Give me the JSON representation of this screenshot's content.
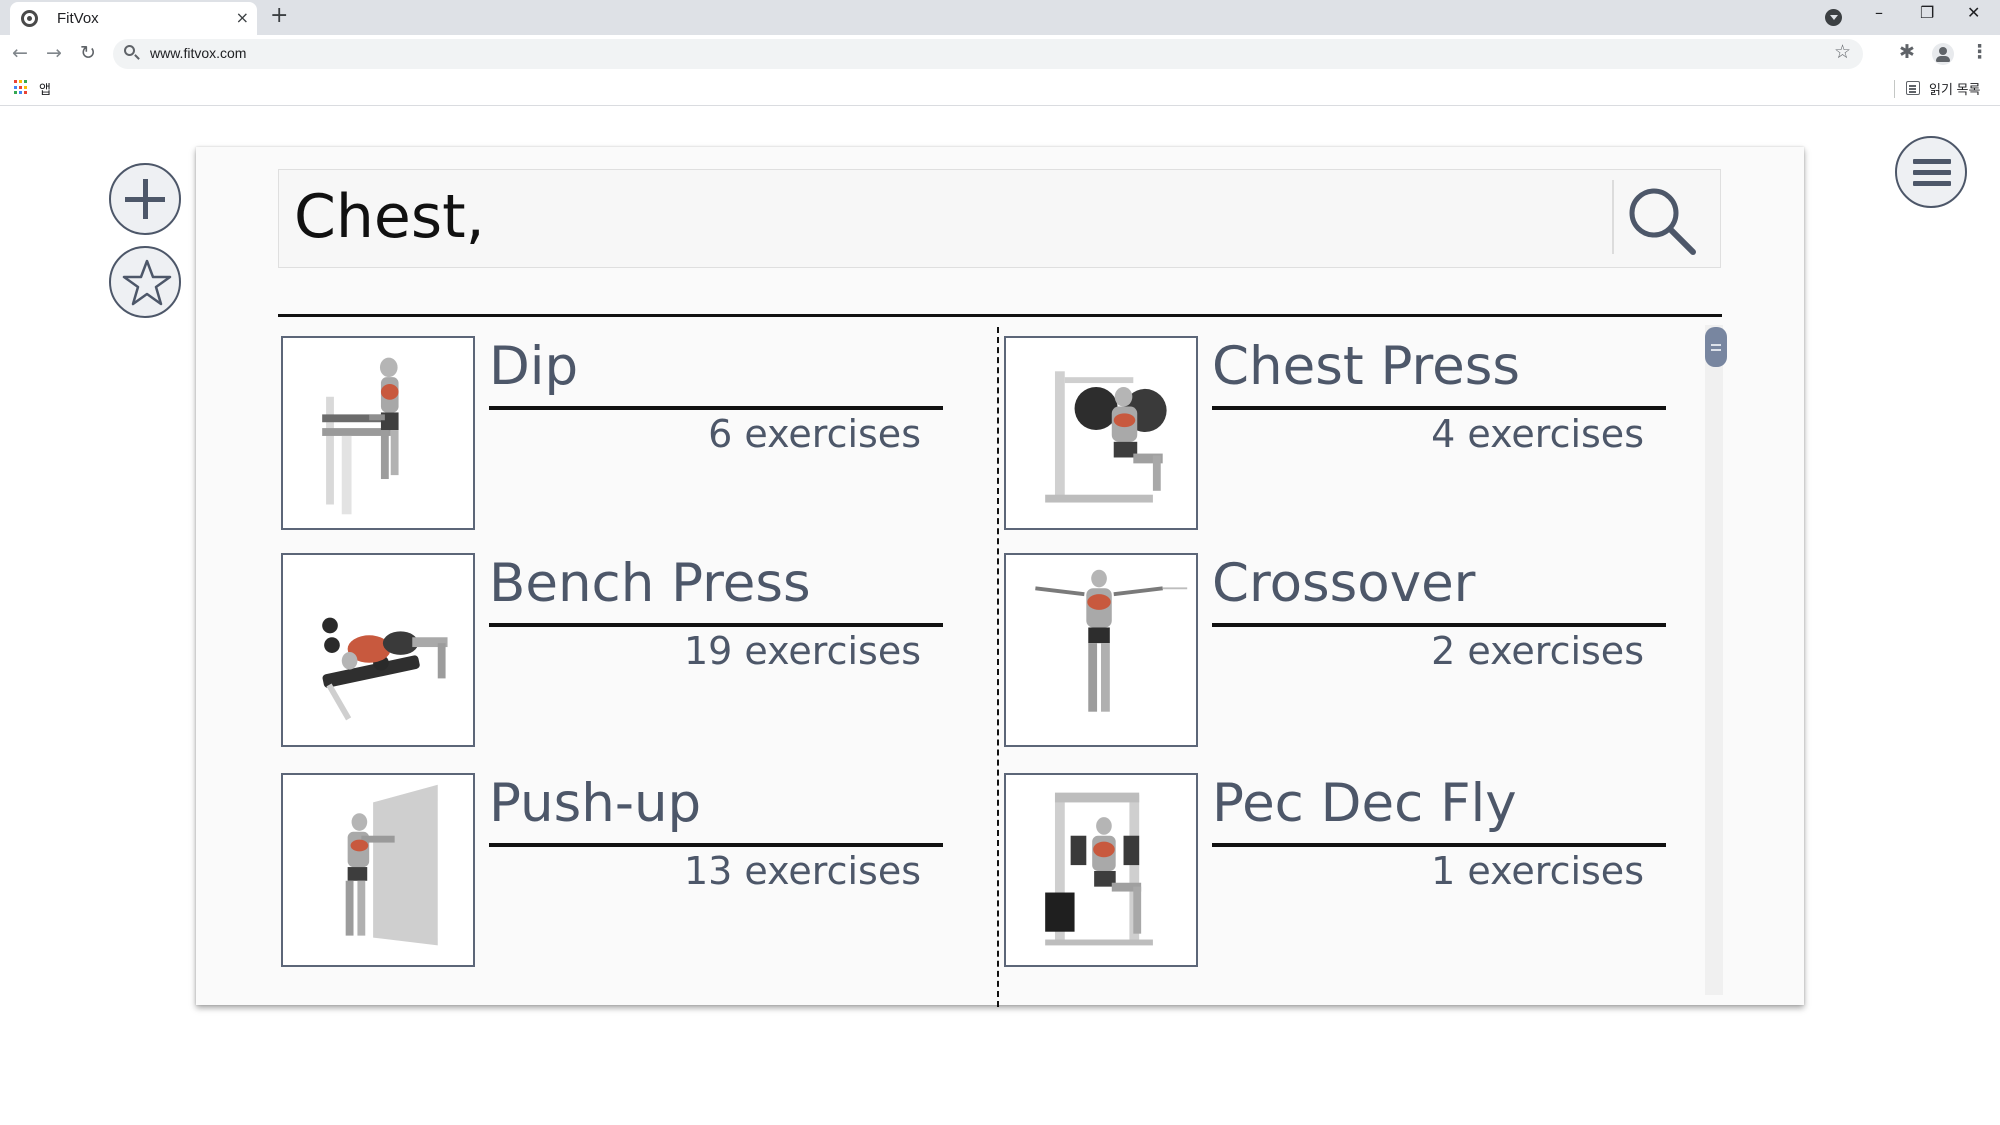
{
  "browser": {
    "tab_title": "FitVox",
    "tab_close": "×",
    "new_tab": "+",
    "url": "www.fitvox.com",
    "apps_label": "앱",
    "reading_list_label": "읽기 목록",
    "window_controls": [
      "–",
      "❐",
      "✕"
    ]
  },
  "app": {
    "search_query": "Chest,",
    "categories": [
      {
        "name": "Dip",
        "count": "6 exercises",
        "icon": "dip-exercise-illustration"
      },
      {
        "name": "Chest Press",
        "count": "4 exercises",
        "icon": "chest-press-machine-illustration"
      },
      {
        "name": "Bench Press",
        "count": "19 exercises",
        "icon": "bench-press-illustration"
      },
      {
        "name": "Crossover",
        "count": "2 exercises",
        "icon": "cable-crossover-illustration"
      },
      {
        "name": "Push-up",
        "count": "13 exercises",
        "icon": "wall-push-up-illustration"
      },
      {
        "name": "Pec Dec Fly",
        "count": "1 exercises",
        "icon": "pec-dec-machine-illustration"
      }
    ],
    "accent_color": "#4d5769",
    "muscle_highlight_color": "#c8593e"
  }
}
